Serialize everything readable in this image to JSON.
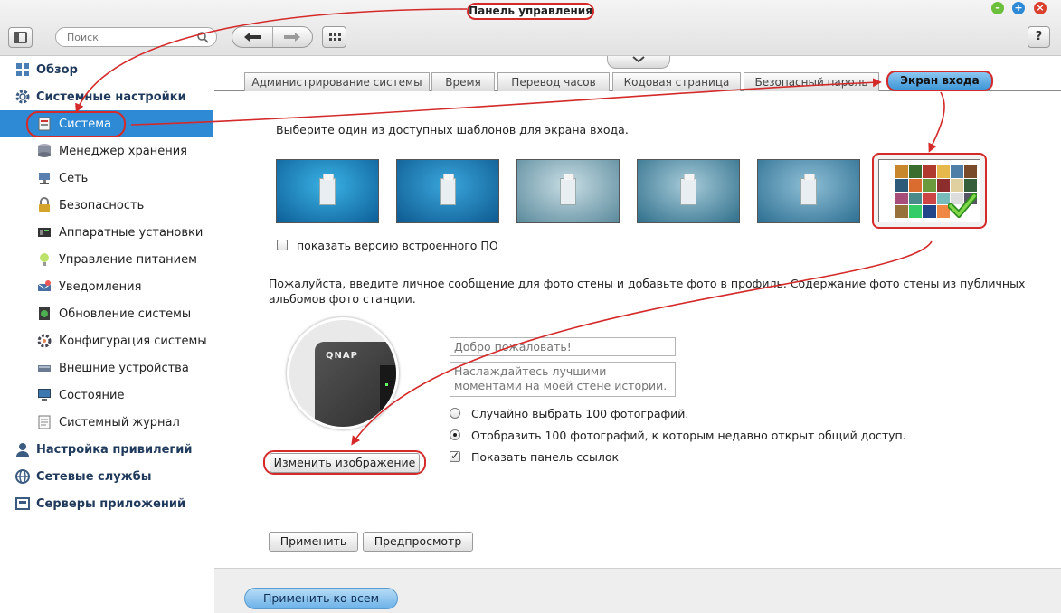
{
  "window": {
    "title_callout": "Панель управления"
  },
  "toolbar": {
    "search_placeholder": "Поиск",
    "back_icon": "arrow-left-icon",
    "forward_icon": "arrow-right-icon",
    "help_label": "?"
  },
  "window_controls": [
    {
      "name": "minimize",
      "glyph": "–",
      "color": "#6cbf3a"
    },
    {
      "name": "maximize",
      "glyph": "+",
      "color": "#2f8ad6"
    },
    {
      "name": "close",
      "glyph": "×",
      "color": "#d9412e"
    }
  ],
  "sidebar": {
    "items": [
      {
        "label": "Обзор",
        "level": "top",
        "icon": "overview-icon"
      },
      {
        "label": "Системные настройки",
        "level": "top",
        "icon": "gear-icon"
      },
      {
        "label": "Система",
        "level": "sub",
        "icon": "system-icon",
        "active": true
      },
      {
        "label": "Менеджер хранения",
        "level": "sub",
        "icon": "storage-icon"
      },
      {
        "label": "Сеть",
        "level": "sub",
        "icon": "network-icon"
      },
      {
        "label": "Безопасность",
        "level": "sub",
        "icon": "lock-icon"
      },
      {
        "label": "Аппаратные установки",
        "level": "sub",
        "icon": "hardware-icon"
      },
      {
        "label": "Управление питанием",
        "level": "sub",
        "icon": "power-icon"
      },
      {
        "label": "Уведомления",
        "level": "sub",
        "icon": "notification-icon"
      },
      {
        "label": "Обновление системы",
        "level": "sub",
        "icon": "update-icon"
      },
      {
        "label": "Конфигурация системы",
        "level": "sub",
        "icon": "config-icon"
      },
      {
        "label": "Внешние устройства",
        "level": "sub",
        "icon": "external-device-icon"
      },
      {
        "label": "Состояние",
        "level": "sub",
        "icon": "monitor-icon"
      },
      {
        "label": "Системный журнал",
        "level": "sub",
        "icon": "log-icon"
      },
      {
        "label": "Настройка привилегий",
        "level": "top",
        "icon": "privilege-icon"
      },
      {
        "label": "Сетевые службы",
        "level": "top",
        "icon": "globe-icon"
      },
      {
        "label": "Серверы приложений",
        "level": "top",
        "icon": "app-server-icon"
      }
    ]
  },
  "tabs": [
    {
      "label": "Администрирование системы",
      "active": false
    },
    {
      "label": "Время",
      "active": false
    },
    {
      "label": "Перевод часов",
      "active": false
    },
    {
      "label": "Кодовая страница",
      "active": false
    },
    {
      "label": "Безопасный пароль",
      "active": false
    },
    {
      "label": "Экран входа",
      "active": true
    }
  ],
  "login_screen": {
    "templates_description": "Выберите один из доступных шаблонов для экрана входа.",
    "template_colors": [
      "#1a8bc4",
      "#1a7fb8",
      "#7fa6b4",
      "#4d8fa6",
      "#3f87a8"
    ],
    "show_firmware_label": "показать версию встроенного ПО",
    "show_firmware_checked": false,
    "photo_wall_description": "Пожалуйста, введите личное сообщение для фото стены и добавьте фото в профиль. Содержание фото стены из публичных альбомов фото станции.",
    "welcome_placeholder": "Добро пожаловать!",
    "message_placeholder": "Наслаждайтесь лучшими моментами на моей стене истории.",
    "avatar_logo": "QNAP",
    "radio_random_label": "Случайно выбрать 100 фотографий.",
    "radio_random_selected": false,
    "radio_shared_label": "Отобразить 100 фотографий, к которым недавно открыт общий доступ.",
    "radio_shared_selected": true,
    "show_links_label": "Показать панель ссылок",
    "show_links_checked": true,
    "change_image_label": "Изменить изображение",
    "apply_label": "Применить",
    "preview_label": "Предпросмотр"
  },
  "footer": {
    "apply_all_label": "Применить ко всем"
  },
  "annotation_color": "#d42a2a"
}
